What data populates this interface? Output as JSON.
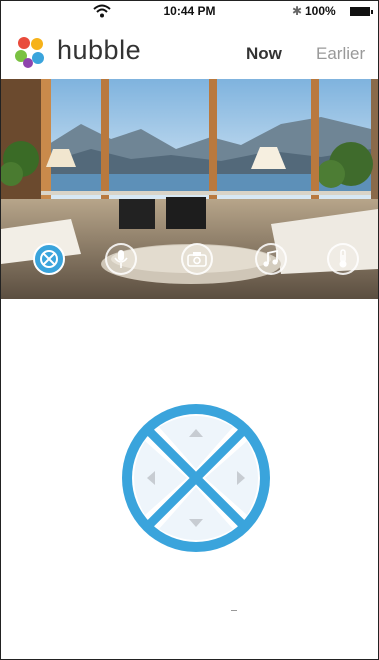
{
  "status_bar": {
    "time": "10:44 PM",
    "battery": "100%",
    "icons": [
      "wifi-icon",
      "bluetooth-icon",
      "battery-icon"
    ]
  },
  "header": {
    "brand": "hubble",
    "tabs": [
      {
        "label": "Now",
        "active": true
      },
      {
        "label": "Earlier",
        "active": false
      }
    ]
  },
  "toolbar": {
    "tools": [
      {
        "name": "pan-tilt-icon",
        "active": true
      },
      {
        "name": "microphone-icon",
        "active": false
      },
      {
        "name": "camera-icon",
        "active": false
      },
      {
        "name": "music-icon",
        "active": false
      },
      {
        "name": "thermometer-icon",
        "active": false
      }
    ]
  },
  "colors": {
    "accent": "#3aa4dc",
    "dpad_fill": "#eef5fb",
    "arrow": "#c7ccd2"
  }
}
